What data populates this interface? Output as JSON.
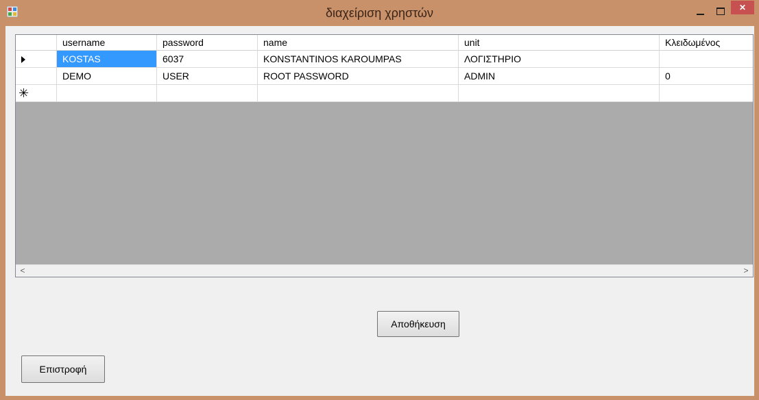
{
  "window": {
    "title": "διαχείριση χρηστών",
    "close_glyph": "✕"
  },
  "grid": {
    "columns": [
      "username",
      "password",
      "name",
      "unit",
      "Κλειδωμένος"
    ],
    "rows": [
      [
        "KOSTAS",
        "6037",
        "KONSTANTINOS KAROUMPAS",
        "ΛΟΓΙΣΤΗΡΙΟ",
        ""
      ],
      [
        "DEMO",
        "USER",
        "ROOT PASSWORD",
        "ADMIN",
        "0"
      ]
    ],
    "new_row_glyph": "✳",
    "scroll_left_glyph": "<",
    "scroll_right_glyph": ">"
  },
  "buttons": {
    "save_label": "Αποθήκευση",
    "back_label": "Επιστροφή"
  },
  "colors": {
    "title_bar": "#c8916a",
    "selection": "#3399ff",
    "grid_background": "#ababab",
    "close_button": "#c75050"
  }
}
